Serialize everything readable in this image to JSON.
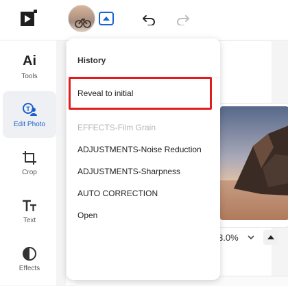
{
  "sidebar": {
    "items": [
      {
        "label": "Tools",
        "icon": "ai-icon",
        "symbol": "Ai"
      },
      {
        "label": "Edit Photo",
        "icon": "edit-photo-icon",
        "active": true
      },
      {
        "label": "Crop",
        "icon": "crop-icon"
      },
      {
        "label": "Text",
        "icon": "text-icon"
      },
      {
        "label": "Effects",
        "icon": "effects-icon"
      }
    ]
  },
  "history": {
    "title": "History",
    "items": [
      {
        "label": "Reveal to initial",
        "disabled": false,
        "highlighted": true
      },
      {
        "label": "EFFECTS-Film Grain",
        "disabled": true
      },
      {
        "label": "ADJUSTMENTS-Noise Reduction",
        "disabled": false
      },
      {
        "label": "ADJUSTMENTS-Sharpness",
        "disabled": false
      },
      {
        "label": "AUTO CORRECTION",
        "disabled": false
      },
      {
        "label": "Open",
        "disabled": false
      }
    ]
  },
  "canvas": {
    "zoom": "3.0%"
  },
  "colors": {
    "accent": "#1763d6",
    "highlight": "#e31b1b",
    "disabled_text": "#b5b5b5"
  }
}
